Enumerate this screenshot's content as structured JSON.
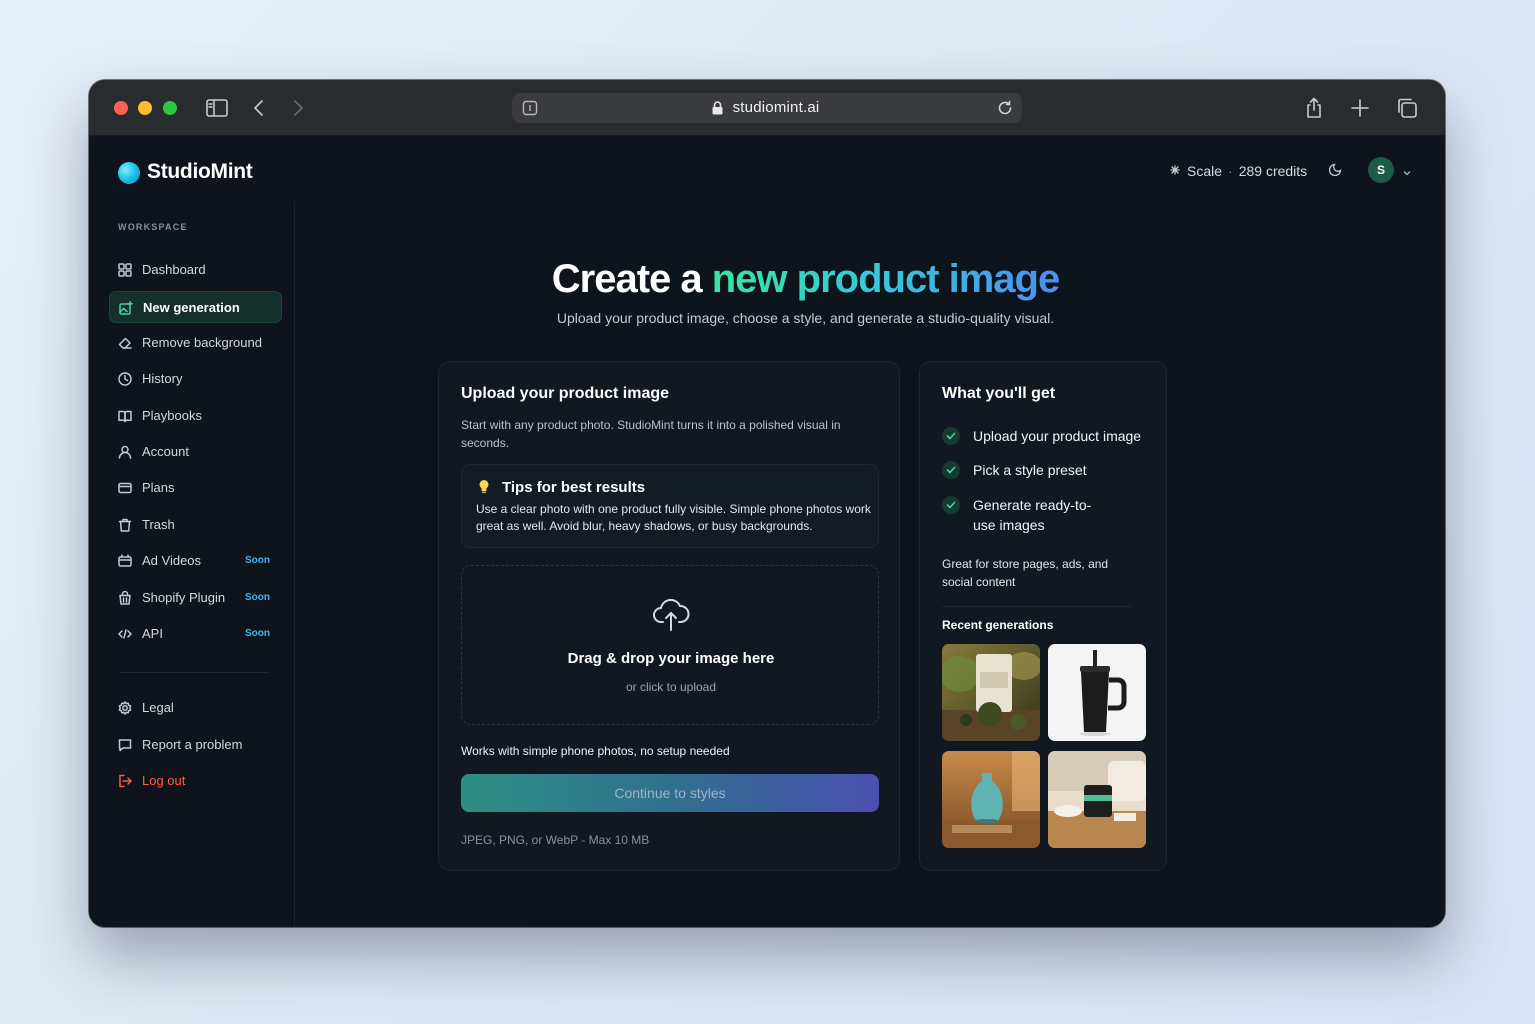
{
  "browser": {
    "url": "studiomint.ai"
  },
  "header": {
    "logo": "StudioMint",
    "plan": "Scale",
    "separator": "·",
    "credits": "289 credits",
    "avatar_initial": "S"
  },
  "sidebar": {
    "section": "WORKSPACE",
    "items": [
      {
        "label": "Dashboard",
        "icon": "grid-icon"
      },
      {
        "label": "New generation",
        "icon": "image-plus-icon",
        "active": true
      },
      {
        "label": "Remove background",
        "icon": "eraser-icon"
      },
      {
        "label": "History",
        "icon": "clock-icon"
      },
      {
        "label": "Playbooks",
        "icon": "book-icon"
      },
      {
        "label": "Account",
        "icon": "user-icon"
      },
      {
        "label": "Plans",
        "icon": "credit-card-icon"
      },
      {
        "label": "Trash",
        "icon": "trash-icon"
      },
      {
        "label": "Ad Videos",
        "icon": "video-icon",
        "badge": "Soon"
      },
      {
        "label": "Shopify Plugin",
        "icon": "shopping-bag-icon",
        "badge": "Soon"
      },
      {
        "label": "API",
        "icon": "code-icon",
        "badge": "Soon"
      }
    ],
    "footer_items": [
      {
        "label": "Legal",
        "icon": "settings-icon"
      },
      {
        "label": "Report a problem",
        "icon": "message-icon"
      },
      {
        "label": "Log out",
        "icon": "logout-icon"
      }
    ]
  },
  "hero": {
    "title_plain": "Create a ",
    "title_accent": "new product image",
    "subtitle": "Upload your product image, choose a style, and generate a studio-quality visual."
  },
  "upload": {
    "title": "Upload your product image",
    "description": "Start with any product photo. StudioMint turns it into a polished visual in seconds.",
    "tips_title": "Tips for best results",
    "tips_body": "Use a clear photo with one product fully visible. Simple phone photos work great as well. Avoid blur, heavy shadows, or busy backgrounds.",
    "drop_title": "Drag & drop your image here",
    "drop_sub": "or click to upload",
    "works_note": "Works with simple phone photos, no setup needed",
    "continue_label": "Continue to styles",
    "file_note": "JPEG, PNG, or WebP - Max 10 MB"
  },
  "info": {
    "title": "What you'll get",
    "checks": [
      "Upload your product image",
      "Pick a style preset",
      "Generate ready-to-use images"
    ],
    "note": "Great for store pages, ads, and social content",
    "recent_label": "Recent generations"
  },
  "colors": {
    "accent_green": "#38e4a3",
    "accent_blue": "#4c8ef0",
    "logout_red": "#ff5a4a",
    "soon_badge": "#3fb7f0"
  }
}
